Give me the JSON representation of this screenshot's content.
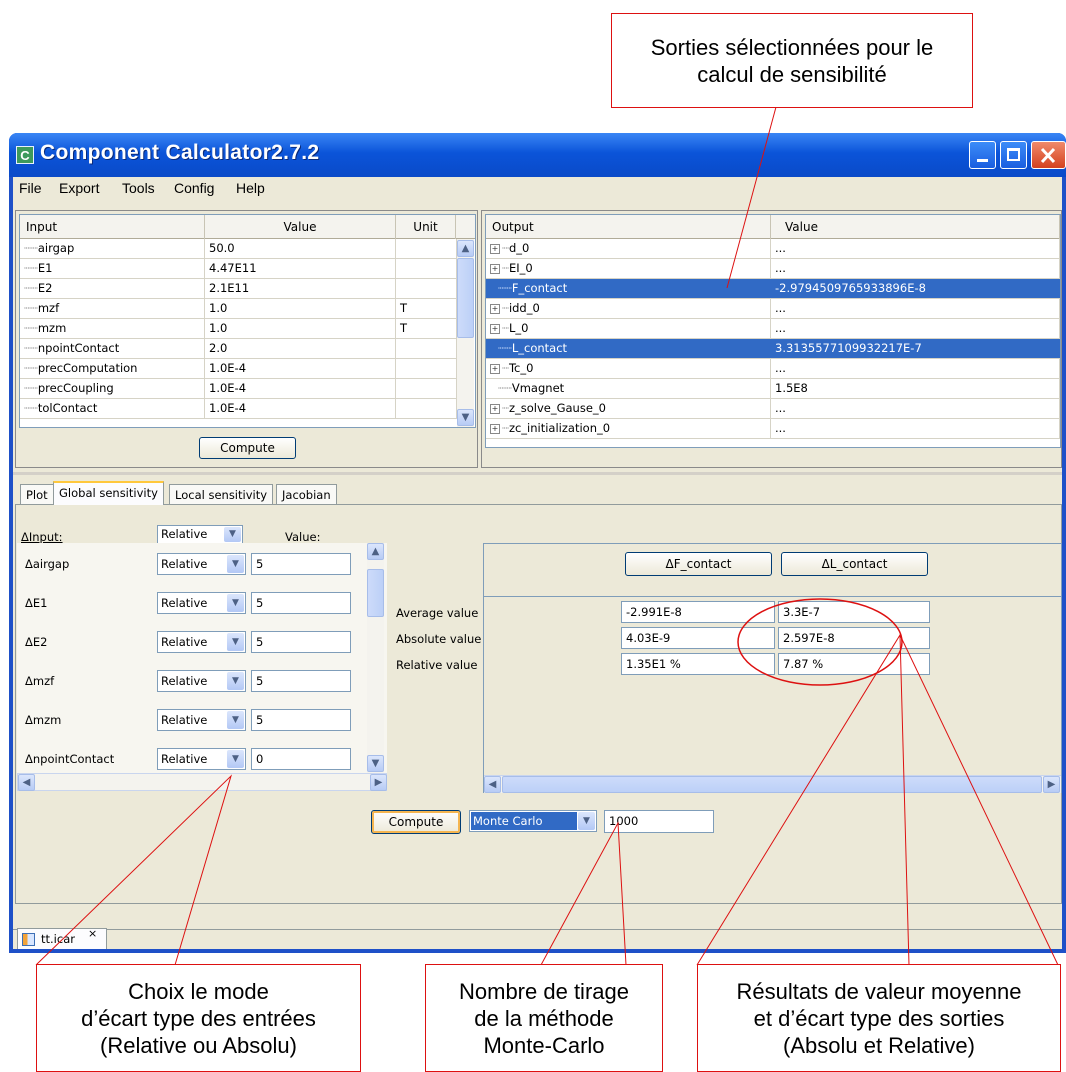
{
  "window": {
    "app_icon_letter": "C",
    "title": "Component Calculator2.7.2"
  },
  "menu": [
    "File",
    "Export",
    "Tools",
    "Config",
    "Help"
  ],
  "input_table": {
    "headers": [
      "Input",
      "Value",
      "Unit"
    ],
    "rows": [
      {
        "name": "airgap",
        "value": "50.0",
        "unit": ""
      },
      {
        "name": "E1",
        "value": "4.47E11",
        "unit": ""
      },
      {
        "name": "E2",
        "value": "2.1E11",
        "unit": ""
      },
      {
        "name": "mzf",
        "value": "1.0",
        "unit": "T"
      },
      {
        "name": "mzm",
        "value": "1.0",
        "unit": "T"
      },
      {
        "name": "npointContact",
        "value": "2.0",
        "unit": ""
      },
      {
        "name": "precComputation",
        "value": "1.0E-4",
        "unit": ""
      },
      {
        "name": "precCoupling",
        "value": "1.0E-4",
        "unit": ""
      },
      {
        "name": "tolContact",
        "value": "1.0E-4",
        "unit": ""
      }
    ],
    "compute_label": "Compute"
  },
  "output_table": {
    "headers": [
      "Output",
      "Value"
    ],
    "rows": [
      {
        "name": "d_0",
        "value": "...",
        "expandable": true,
        "selected": false
      },
      {
        "name": "EI_0",
        "value": "...",
        "expandable": true,
        "selected": false
      },
      {
        "name": "F_contact",
        "value": "-2.9794509765933896E-8",
        "expandable": false,
        "selected": true
      },
      {
        "name": "idd_0",
        "value": "...",
        "expandable": true,
        "selected": false
      },
      {
        "name": "L_0",
        "value": "...",
        "expandable": true,
        "selected": false
      },
      {
        "name": "L_contact",
        "value": "3.3135577109932217E-7",
        "expandable": false,
        "selected": true
      },
      {
        "name": "Tc_0",
        "value": "...",
        "expandable": true,
        "selected": false
      },
      {
        "name": "Vmagnet",
        "value": "1.5E8",
        "expandable": false,
        "selected": false
      },
      {
        "name": "z_solve_Gause_0",
        "value": "...",
        "expandable": true,
        "selected": false
      },
      {
        "name": "zc_initialization_0",
        "value": "...",
        "expandable": true,
        "selected": false
      }
    ]
  },
  "tabs": [
    "Plot",
    "Global sensitivity",
    "Local sensitivity",
    "Jacobian"
  ],
  "active_tab": "Global sensitivity",
  "sensitivity": {
    "header_label": "ΔInput:",
    "header_mode": "Relative",
    "header_value_label": "Value:",
    "inputs": [
      {
        "label": "Δairgap",
        "mode": "Relative",
        "value": "5"
      },
      {
        "label": "ΔE1",
        "mode": "Relative",
        "value": "5"
      },
      {
        "label": "ΔE2",
        "mode": "Relative",
        "value": "5"
      },
      {
        "label": "Δmzf",
        "mode": "Relative",
        "value": "5"
      },
      {
        "label": "Δmzm",
        "mode": "Relative",
        "value": "5"
      },
      {
        "label": "ΔnpointContact",
        "mode": "Relative",
        "value": "0"
      }
    ]
  },
  "results": {
    "output_buttons": [
      "ΔF_contact",
      "ΔL_contact"
    ],
    "row_labels": [
      "Average value",
      "Absolute value",
      "Relative value"
    ],
    "values": [
      [
        "-2.991E-8",
        "3.3E-7"
      ],
      [
        "4.03E-9",
        "2.597E-8"
      ],
      [
        "1.35E1 %",
        "7.87 %"
      ]
    ]
  },
  "bottom": {
    "compute_label": "Compute",
    "method": "Monte Carlo",
    "samples": "1000"
  },
  "file_tab": {
    "name": "tt.icar",
    "close": "×"
  },
  "annotations": {
    "top": "Sorties sélectionnées pour le\ncalcul de sensibilité",
    "bottom_left": "Choix le mode\nd’écart type des entrées\n(Relative ou Absolu)",
    "bottom_middle": "Nombre de tirage\nde la méthode\nMonte-Carlo",
    "bottom_right": "Résultats de valeur moyenne\net d’écart type des sorties\n(Absolu et Relative)"
  },
  "colors": {
    "title_bar": "#0b54d9",
    "selection": "#316ac5",
    "annotation": "#dd1111",
    "active_tab_accent": "#ffc83c"
  }
}
